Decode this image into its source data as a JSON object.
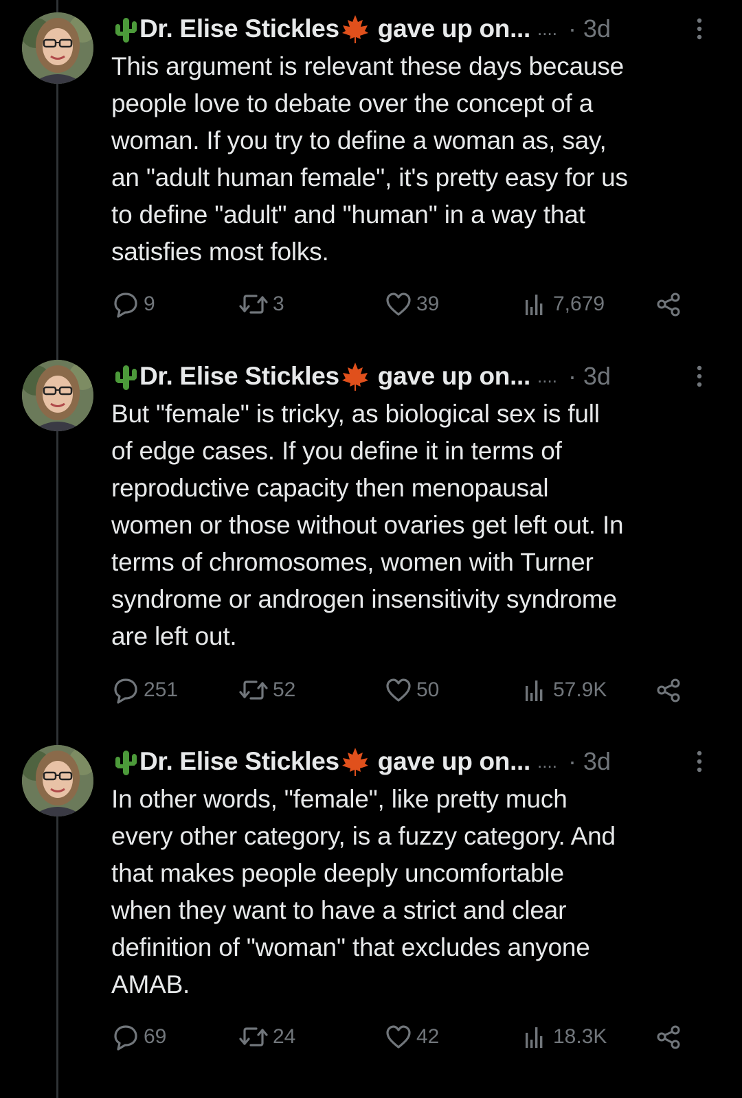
{
  "colors": {
    "background": "#000000",
    "text_primary": "#e7e9ea",
    "text_secondary": "#71767b",
    "thread_line": "#2f3336",
    "cactus": "#4c9a3a",
    "maple_leaf": "#e0501c"
  },
  "icons": {
    "name_prefix": "cactus-icon",
    "name_suffix": "maple-leaf-icon",
    "more": "more-vertical-icon",
    "reply": "reply-bubble-icon",
    "retweet": "retweet-icon",
    "like": "heart-icon",
    "views": "views-bars-icon",
    "share": "share-icon"
  },
  "tweets": [
    {
      "author": "Dr. Elise Stickles",
      "display_extra": "gave up on...",
      "ellipsis": "....",
      "time": "· 3d",
      "lines": [
        "This argument is relevant these days because",
        "people love to debate over the concept of a",
        "woman. If you try to define a woman as, say,",
        "an \"adult human female\", it's pretty easy for us",
        "to define \"adult\" and \"human\" in a way that",
        "satisfies most folks."
      ],
      "stats": {
        "replies": "9",
        "retweets": "3",
        "likes": "39",
        "views": "7,679"
      }
    },
    {
      "author": "Dr. Elise Stickles",
      "display_extra": "gave up on...",
      "ellipsis": "....",
      "time": "· 3d",
      "lines": [
        "But \"female\" is tricky, as biological sex is full",
        "of edge cases. If you define it in terms of",
        "reproductive capacity then menopausal",
        "women or those without ovaries get left out. In",
        "terms of chromosomes, women with Turner",
        "syndrome or androgen insensitivity syndrome",
        "are left out."
      ],
      "stats": {
        "replies": "251",
        "retweets": "52",
        "likes": "50",
        "views": "57.9K"
      }
    },
    {
      "author": "Dr. Elise Stickles",
      "display_extra": "gave up on...",
      "ellipsis": "....",
      "time": "· 3d",
      "lines": [
        "In other words, \"female\", like pretty much",
        "every other category, is a fuzzy category. And",
        "that makes people deeply uncomfortable",
        "when they want to have a strict and clear",
        "definition of \"woman\" that excludes anyone",
        "AMAB."
      ],
      "stats": {
        "replies": "69",
        "retweets": "24",
        "likes": "42",
        "views": "18.3K"
      }
    }
  ]
}
